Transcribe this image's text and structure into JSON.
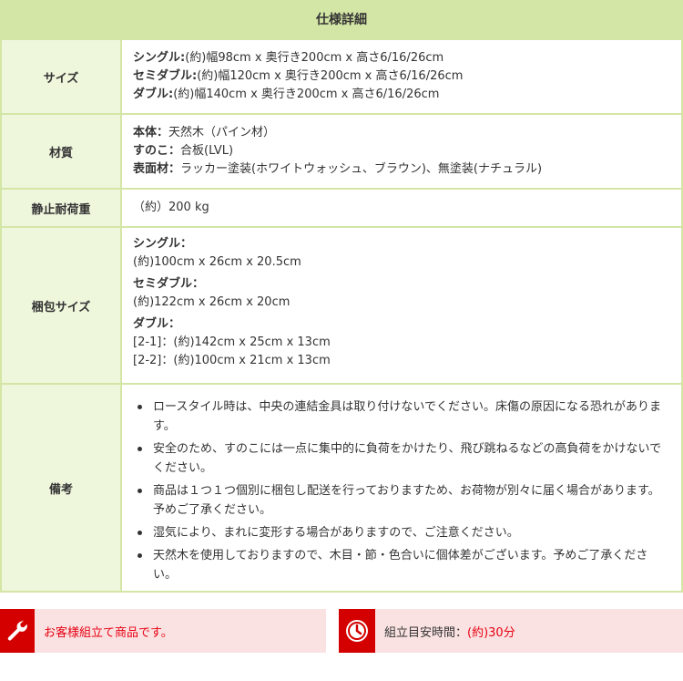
{
  "title": "仕様詳細",
  "size": {
    "label": "サイズ",
    "single_h": "シングル:",
    "single_v": "(約)幅98cm x 奥行き200cm x 高さ6/16/26cm",
    "semi_h": "セミダブル:",
    "semi_v": "(約)幅120cm x 奥行き200cm x 高さ6/16/26cm",
    "double_h": "ダブル:",
    "double_v": "(約)幅140cm x 奥行き200cm x 高さ6/16/26cm"
  },
  "material": {
    "label": "材質",
    "body_h": "本体：",
    "body_v": "天然木（パイン材）",
    "slat_h": "すのこ：",
    "slat_v": "合板(LVL)",
    "surface_h": "表面材：",
    "surface_v": "ラッカー塗装(ホワイトウォッシュ、ブラウン)、無塗装(ナチュラル)"
  },
  "load": {
    "label": "静止耐荷重",
    "value": "（約）200 kg"
  },
  "package": {
    "label": "梱包サイズ",
    "single_h": "シングル：",
    "single_v": "(約)100cm x 26cm x 20.5cm",
    "semi_h": "セミダブル：",
    "semi_v": "(約)122cm x 26cm x 20cm",
    "double_h": "ダブル：",
    "double_v1": "[2-1]：(約)142cm x 25cm x 13cm",
    "double_v2": "[2-2]：(約)100cm x 21cm x 13cm"
  },
  "notes": {
    "label": "備考",
    "items": [
      "ロースタイル時は、中央の連結金具は取り付けないでください。床傷の原因になる恐れがありま す。",
      "安全のため、すのこには一点に集中的に負荷をかけたり、飛び跳ねるなどの高負荷をかけないで ください。",
      "商品は１つ１つ個別に梱包し配送を行っておりますため、お荷物が別々に届く場合があります。予めご了承ください。",
      "湿気により、まれに変形する場合がありますので、ご注意ください。",
      "天然木を使用しておりますので、木目・節・色合いに個体差がございます。予めご了承くださ い。"
    ]
  },
  "assembly": {
    "text": "お客様組立て商品です。",
    "time_label": "組立目安時間：",
    "time_value": "(約)30分",
    "accent": "#d40000"
  }
}
